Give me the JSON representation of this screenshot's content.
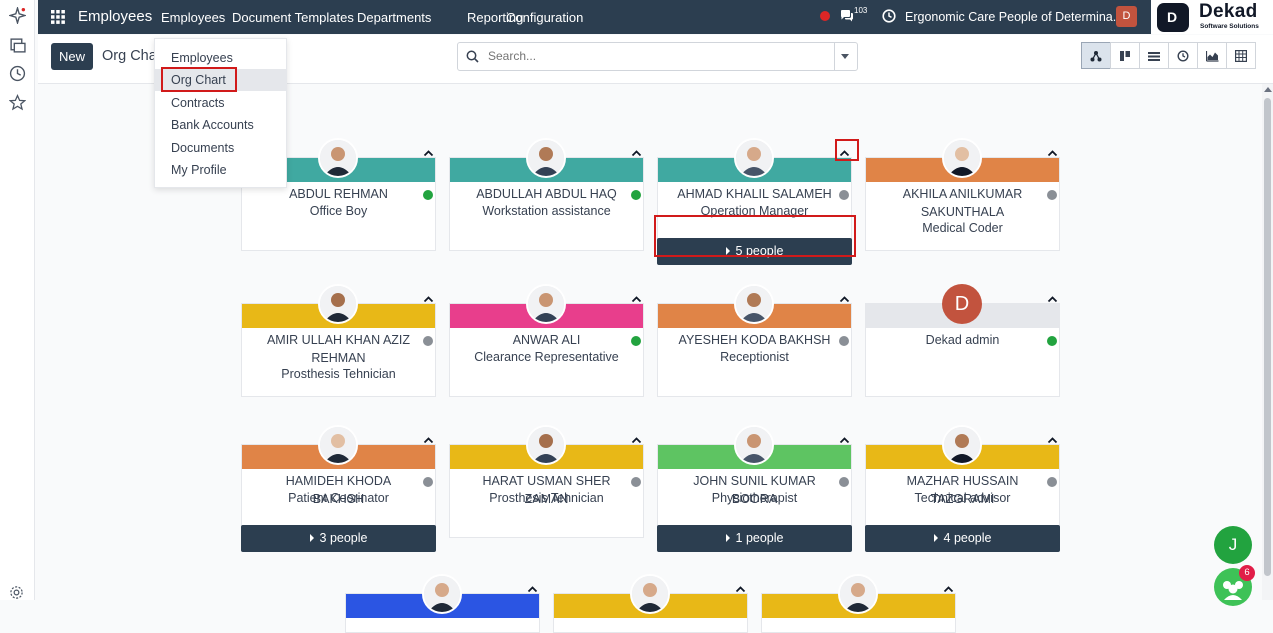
{
  "navbar": {
    "app_name": "Employees",
    "menus": [
      {
        "label": "Employees",
        "active": true
      },
      {
        "label": "Document Templates"
      },
      {
        "label": "Departments"
      },
      {
        "label": "Reporting"
      },
      {
        "label": "Configuration"
      }
    ],
    "chat_count": "103",
    "company": "Ergonomic Care People of Determina...",
    "user_initial": "D"
  },
  "brand": {
    "name": "Dekad",
    "subtitle": "Software Solutions"
  },
  "control": {
    "new_label": "New",
    "breadcrumb": "Org Chart",
    "search_placeholder": "Search..."
  },
  "dropdown": {
    "items": [
      "Employees",
      "Org Chart",
      "Contracts",
      "Bank Accounts",
      "Documents",
      "My Profile"
    ],
    "highlighted": "Org Chart"
  },
  "view_switcher": [
    "hierarchy-icon",
    "kanban-icon",
    "list-icon",
    "activity-icon",
    "graph-icon",
    "pivot-icon"
  ],
  "colors": {
    "teal": "#40a9a1",
    "orange": "#e08447",
    "yellow": "#e8b817",
    "pink": "#e83e8c",
    "gray": "#e5e7eb",
    "green": "#5ec462",
    "blue": "#2b55e3",
    "online": "#22a33f",
    "offline": "#8a8f96"
  },
  "employees": [
    {
      "name": "ABDUL REHMAN",
      "job": "Office Boy",
      "band": "#40a9a1",
      "online": true
    },
    {
      "name": "ABDULLAH ABDUL HAQ",
      "job": "Workstation assistance",
      "band": "#40a9a1",
      "online": true
    },
    {
      "name": "AHMAD KHALIL SALAMEH",
      "job": "Operation Manager",
      "band": "#40a9a1",
      "online": false,
      "people": "5 people"
    },
    {
      "name": "AKHILA ANILKUMAR SAKUNTHALA",
      "job": "Medical Coder",
      "band": "#e08447",
      "online": false
    },
    {
      "name": "AMIR ULLAH KHAN AZIZ REHMAN",
      "job": "Prosthesis Tehnician",
      "band": "#e8b817",
      "online": false
    },
    {
      "name": "ANWAR ALI",
      "job": "Clearance Representative",
      "band": "#e83e8c",
      "online": true
    },
    {
      "name": "AYESHEH KODA BAKHSH",
      "job": "Receptionist",
      "band": "#e08447",
      "online": false
    },
    {
      "name": "Dekad admin",
      "job": "",
      "band": "#e5e7eb",
      "online": true,
      "initial": "D"
    },
    {
      "name": "HAMIDEH KHODA BAKHSH",
      "job": "Patient Coorinator",
      "band": "#e08447",
      "online": false,
      "people": "3 people"
    },
    {
      "name": "HARAT USMAN SHER ZAMAN",
      "job": "Prosthesis Tehnician",
      "band": "#e8b817",
      "online": false
    },
    {
      "name": "JOHN SUNIL KUMAR BOORA",
      "job": "Physiotherapist",
      "band": "#5ec462",
      "online": false,
      "people": "1 people"
    },
    {
      "name": "MAZHAR HUSSAIN TAZGRAMI",
      "job": "Technical advisor",
      "band": "#e8b817",
      "online": false,
      "people": "4 people"
    }
  ],
  "partial_cards": [
    {
      "band": "#2b55e3"
    },
    {
      "band": "#e8b817"
    },
    {
      "band": "#e8b817"
    }
  ],
  "fab": {
    "letter": "J",
    "badge": "6"
  }
}
